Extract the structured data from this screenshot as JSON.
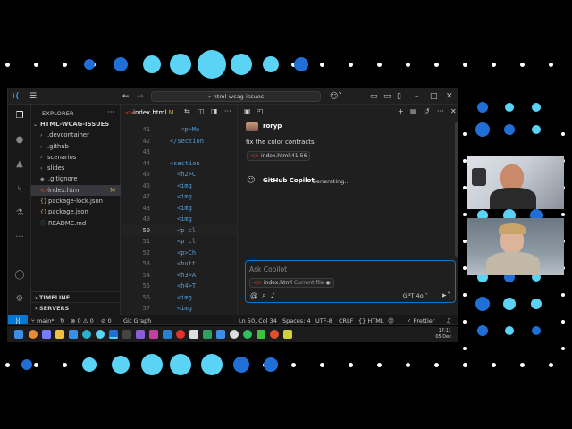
{
  "colors": {
    "accent": "#0078d4",
    "dot_cyan": "#5ad3f5",
    "dot_blue": "#1f6fd6",
    "bg": "#000000"
  },
  "titlebar": {
    "app_icon": "vscode-icon",
    "menu_icon": "hamburger-icon",
    "back_icon": "arrow-left-icon",
    "forward_icon": "arrow-right-icon",
    "search_text": "html-wcag-issues",
    "copilot_icon": "copilot-icon",
    "window_controls": [
      "minimize-icon",
      "restore-icon",
      "close-icon"
    ]
  },
  "activity_bar": [
    "explorer-icon",
    "github-icon",
    "azure-icon",
    "source-control-icon",
    "testing-icon",
    "more-icon",
    "account-icon",
    "settings-icon"
  ],
  "sidebar": {
    "header": "EXPLORER",
    "root": "HTML-WCAG-ISSUES",
    "items": [
      {
        "label": ".devcontainer",
        "type": "folder"
      },
      {
        "label": ".github",
        "type": "folder"
      },
      {
        "label": "scenarios",
        "type": "folder"
      },
      {
        "label": "slides",
        "type": "folder"
      },
      {
        "label": ".gitignore",
        "type": "file"
      },
      {
        "label": "index.html",
        "type": "html",
        "badge": "M",
        "selected": true
      },
      {
        "label": "package-lock.json",
        "type": "json"
      },
      {
        "label": "package.json",
        "type": "json"
      },
      {
        "label": "README.md",
        "type": "md"
      }
    ],
    "timeline": "TIMELINE",
    "servers": "SERVERS"
  },
  "editor": {
    "tab_label": "index.html",
    "tab_badge": "M",
    "lines": [
      {
        "num": "41",
        "code": "<p>Ma"
      },
      {
        "num": "42",
        "code": "</section"
      },
      {
        "num": "43",
        "code": ""
      },
      {
        "num": "44",
        "code": "<section"
      },
      {
        "num": "45",
        "code": "<h2>C"
      },
      {
        "num": "46",
        "code": "<img"
      },
      {
        "num": "47",
        "code": "<img"
      },
      {
        "num": "48",
        "code": "<img"
      },
      {
        "num": "49",
        "code": "<img"
      },
      {
        "num": "50",
        "code": "<p cl"
      },
      {
        "num": "51",
        "code": "<p cl"
      },
      {
        "num": "52",
        "code": "<p>Ch"
      },
      {
        "num": "53",
        "code": "<butt"
      },
      {
        "num": "54",
        "code": "<h3>A"
      },
      {
        "num": "55",
        "code": "<h4>T"
      },
      {
        "num": "56",
        "code": "<img"
      },
      {
        "num": "57",
        "code": "<img"
      }
    ],
    "current_line": "50"
  },
  "chat": {
    "user_name": "roryp",
    "message": "fix the color contracts",
    "reference_chip": "index.html:41-56",
    "assistant_name": "GitHub Copilot",
    "status": "Generating...",
    "placeholder": "Ask Copilot",
    "context_file": "index.html",
    "context_label": "Current file",
    "model": "GPT 4o",
    "toolbar_icons": [
      "chat-icon",
      "history-icon",
      "plus-icon",
      "new-file-icon",
      "history-icon",
      "more-icon",
      "close-icon"
    ]
  },
  "statusbar": {
    "branch": "main*",
    "errors": "0",
    "warnings": "0",
    "ports": "0",
    "git_graph": "Git Graph",
    "position": "Ln 50, Col 34",
    "spaces": "Spaces: 4",
    "encoding": "UTF-8",
    "eol": "CRLF",
    "language": "HTML",
    "prettier": "Prettier"
  },
  "taskbar": {
    "time": "17:11",
    "date": "05 Dec"
  }
}
